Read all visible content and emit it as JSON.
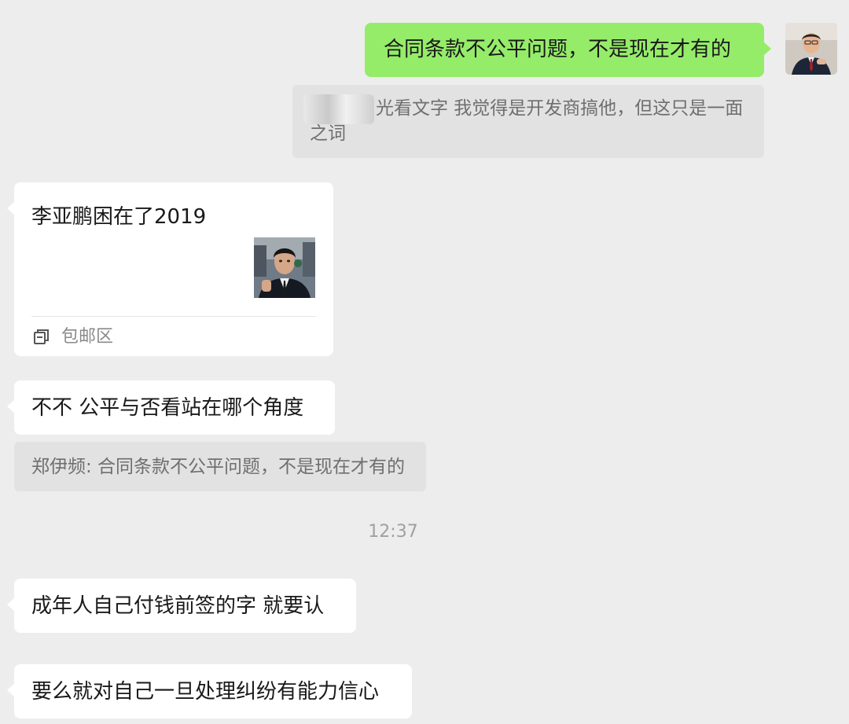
{
  "messages": {
    "sent_1": "合同条款不公平问题，不是现在才有的",
    "quote_1_name": "",
    "quote_1_text": "光看文字 我觉得是开发商搞他，但这只是一面之词",
    "card_title": "李亚鹏困在了2019",
    "card_source": "包邮区",
    "msg_2": "不不 公平与否看站在哪个角度",
    "quote_2": "郑伊频: 合同条款不公平问题，不是现在才有的",
    "timestamp": "12:37",
    "msg_3": "成年人自己付钱前签的字 就要认",
    "msg_4": "要么就对自己一旦处理纠纷有能力信心"
  },
  "colors": {
    "background": "#ededed",
    "sent_bubble": "#95ec69",
    "received_bubble": "#ffffff",
    "quote_bg": "#e2e2e2"
  }
}
